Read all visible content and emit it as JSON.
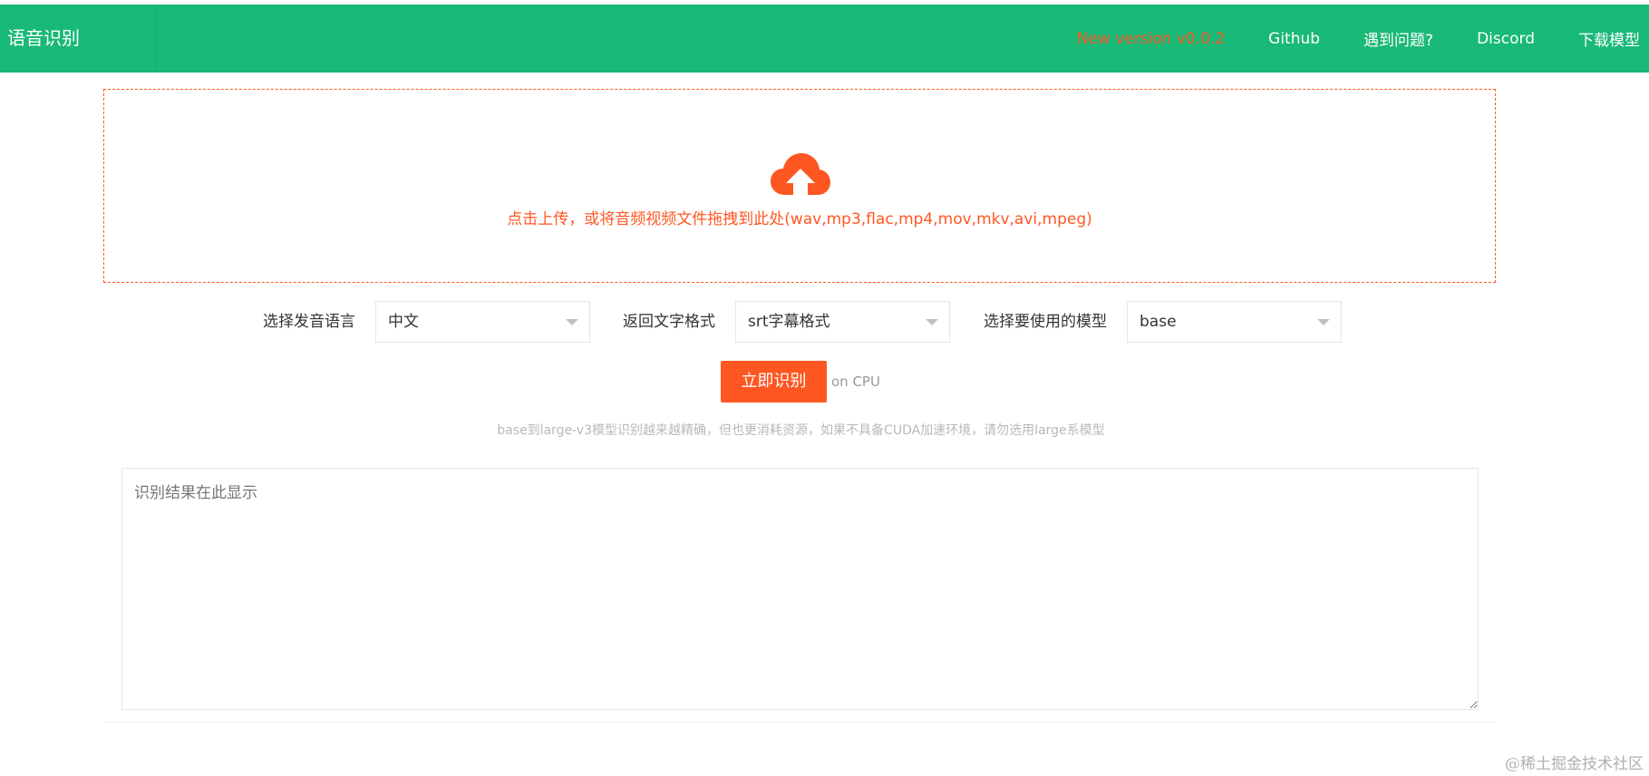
{
  "navbar": {
    "brand": "语音识别",
    "links": [
      {
        "label": "New version v0.0.2",
        "icon": "version-link"
      },
      {
        "label": "Github"
      },
      {
        "label": "遇到问题?"
      },
      {
        "label": "Discord"
      },
      {
        "label": "下载模型"
      }
    ],
    "colors": {
      "background": "#19b978",
      "version": "#ff5722"
    }
  },
  "upload": {
    "icon": "cloud-upload-icon",
    "text": "点击上传，或将音频视频文件拖拽到此处(wav,mp3,flac,mp4,mov,mkv,avi,mpeg)"
  },
  "controls": {
    "language": {
      "label": "选择发音语言",
      "value": "中文"
    },
    "format": {
      "label": "返回文字格式",
      "value": "srt字幕格式"
    },
    "model": {
      "label": "选择要使用的模型",
      "value": "base"
    }
  },
  "action": {
    "run_label": "立即识别",
    "device": "on CPU",
    "accent": "#ff5722"
  },
  "hint": "base到large-v3模型识别越来越精确，但也更消耗资源，如果不具备CUDA加速环境，请勿选用large系模型",
  "result": {
    "placeholder": "识别结果在此显示"
  },
  "watermark": "@稀土掘金技术社区"
}
